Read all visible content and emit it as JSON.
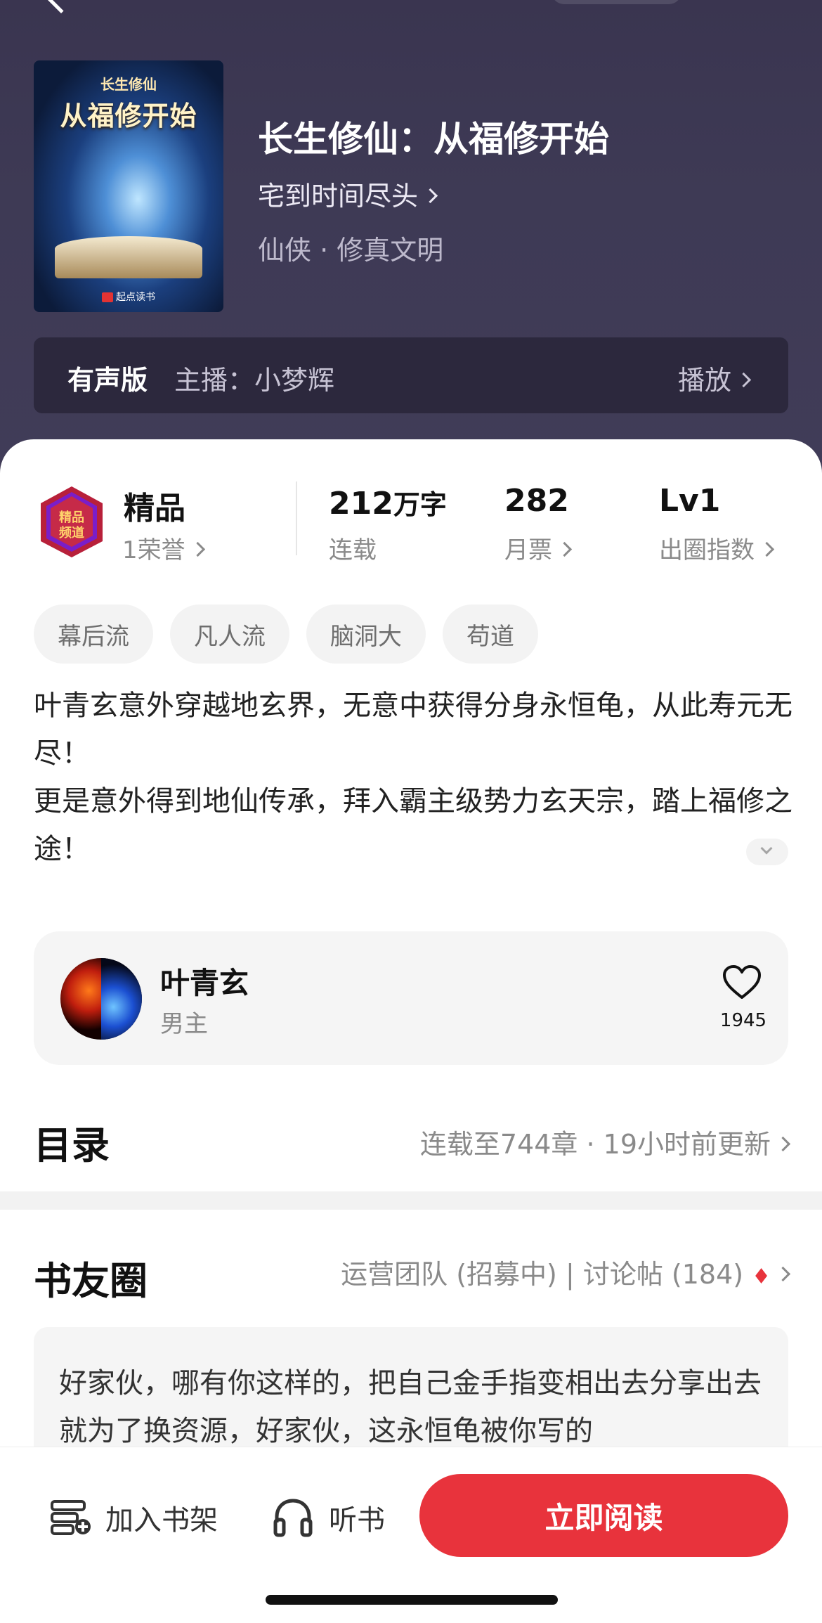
{
  "header": {
    "cover": {
      "small_title": "长生修仙",
      "big_title": "从福修开始",
      "brand": "起点读书"
    },
    "title": "长生修仙：从福修开始",
    "author": "宅到时间尽头",
    "genre": "仙侠 · 修真文明",
    "audio": {
      "tag": "有声版",
      "host": "主播：小梦辉",
      "play_label": "播放"
    }
  },
  "stats": {
    "badge_title": "精品",
    "badge_sub": "1荣誉",
    "words_value": "212",
    "words_unit": "万字",
    "words_sub": "连载",
    "tickets_value": "282",
    "tickets_sub": "月票",
    "level_value": "Lv1",
    "level_sub": "出圈指数"
  },
  "tags": [
    "幕后流",
    "凡人流",
    "脑洞大",
    "苟道"
  ],
  "synopsis": {
    "line1": "叶青玄意外穿越地玄界，无意中获得分身永恒龟，从此寿元无尽！",
    "line2": "更是意外得到地仙传承，拜入霸主级势力玄天宗，踏上福修之途！"
  },
  "character": {
    "name": "叶青玄",
    "role": "男主",
    "likes": "1945"
  },
  "toc": {
    "title": "目录",
    "info": "连载至744章 · 19小时前更新"
  },
  "book_circle": {
    "title": "书友圈",
    "info": "运营团队 (招募中) | 讨论帖 (184)",
    "post_preview": "好家伙，哪有你这样的，把自己金手指变相出去分享出去就为了换资源，好家伙，这永恒龟被你写的"
  },
  "bottom_bar": {
    "shelf_label": "加入书架",
    "listen_label": "听书",
    "read_label": "立即阅读"
  },
  "colors": {
    "accent": "#e8333c",
    "header_bg": "#3e3a55"
  }
}
